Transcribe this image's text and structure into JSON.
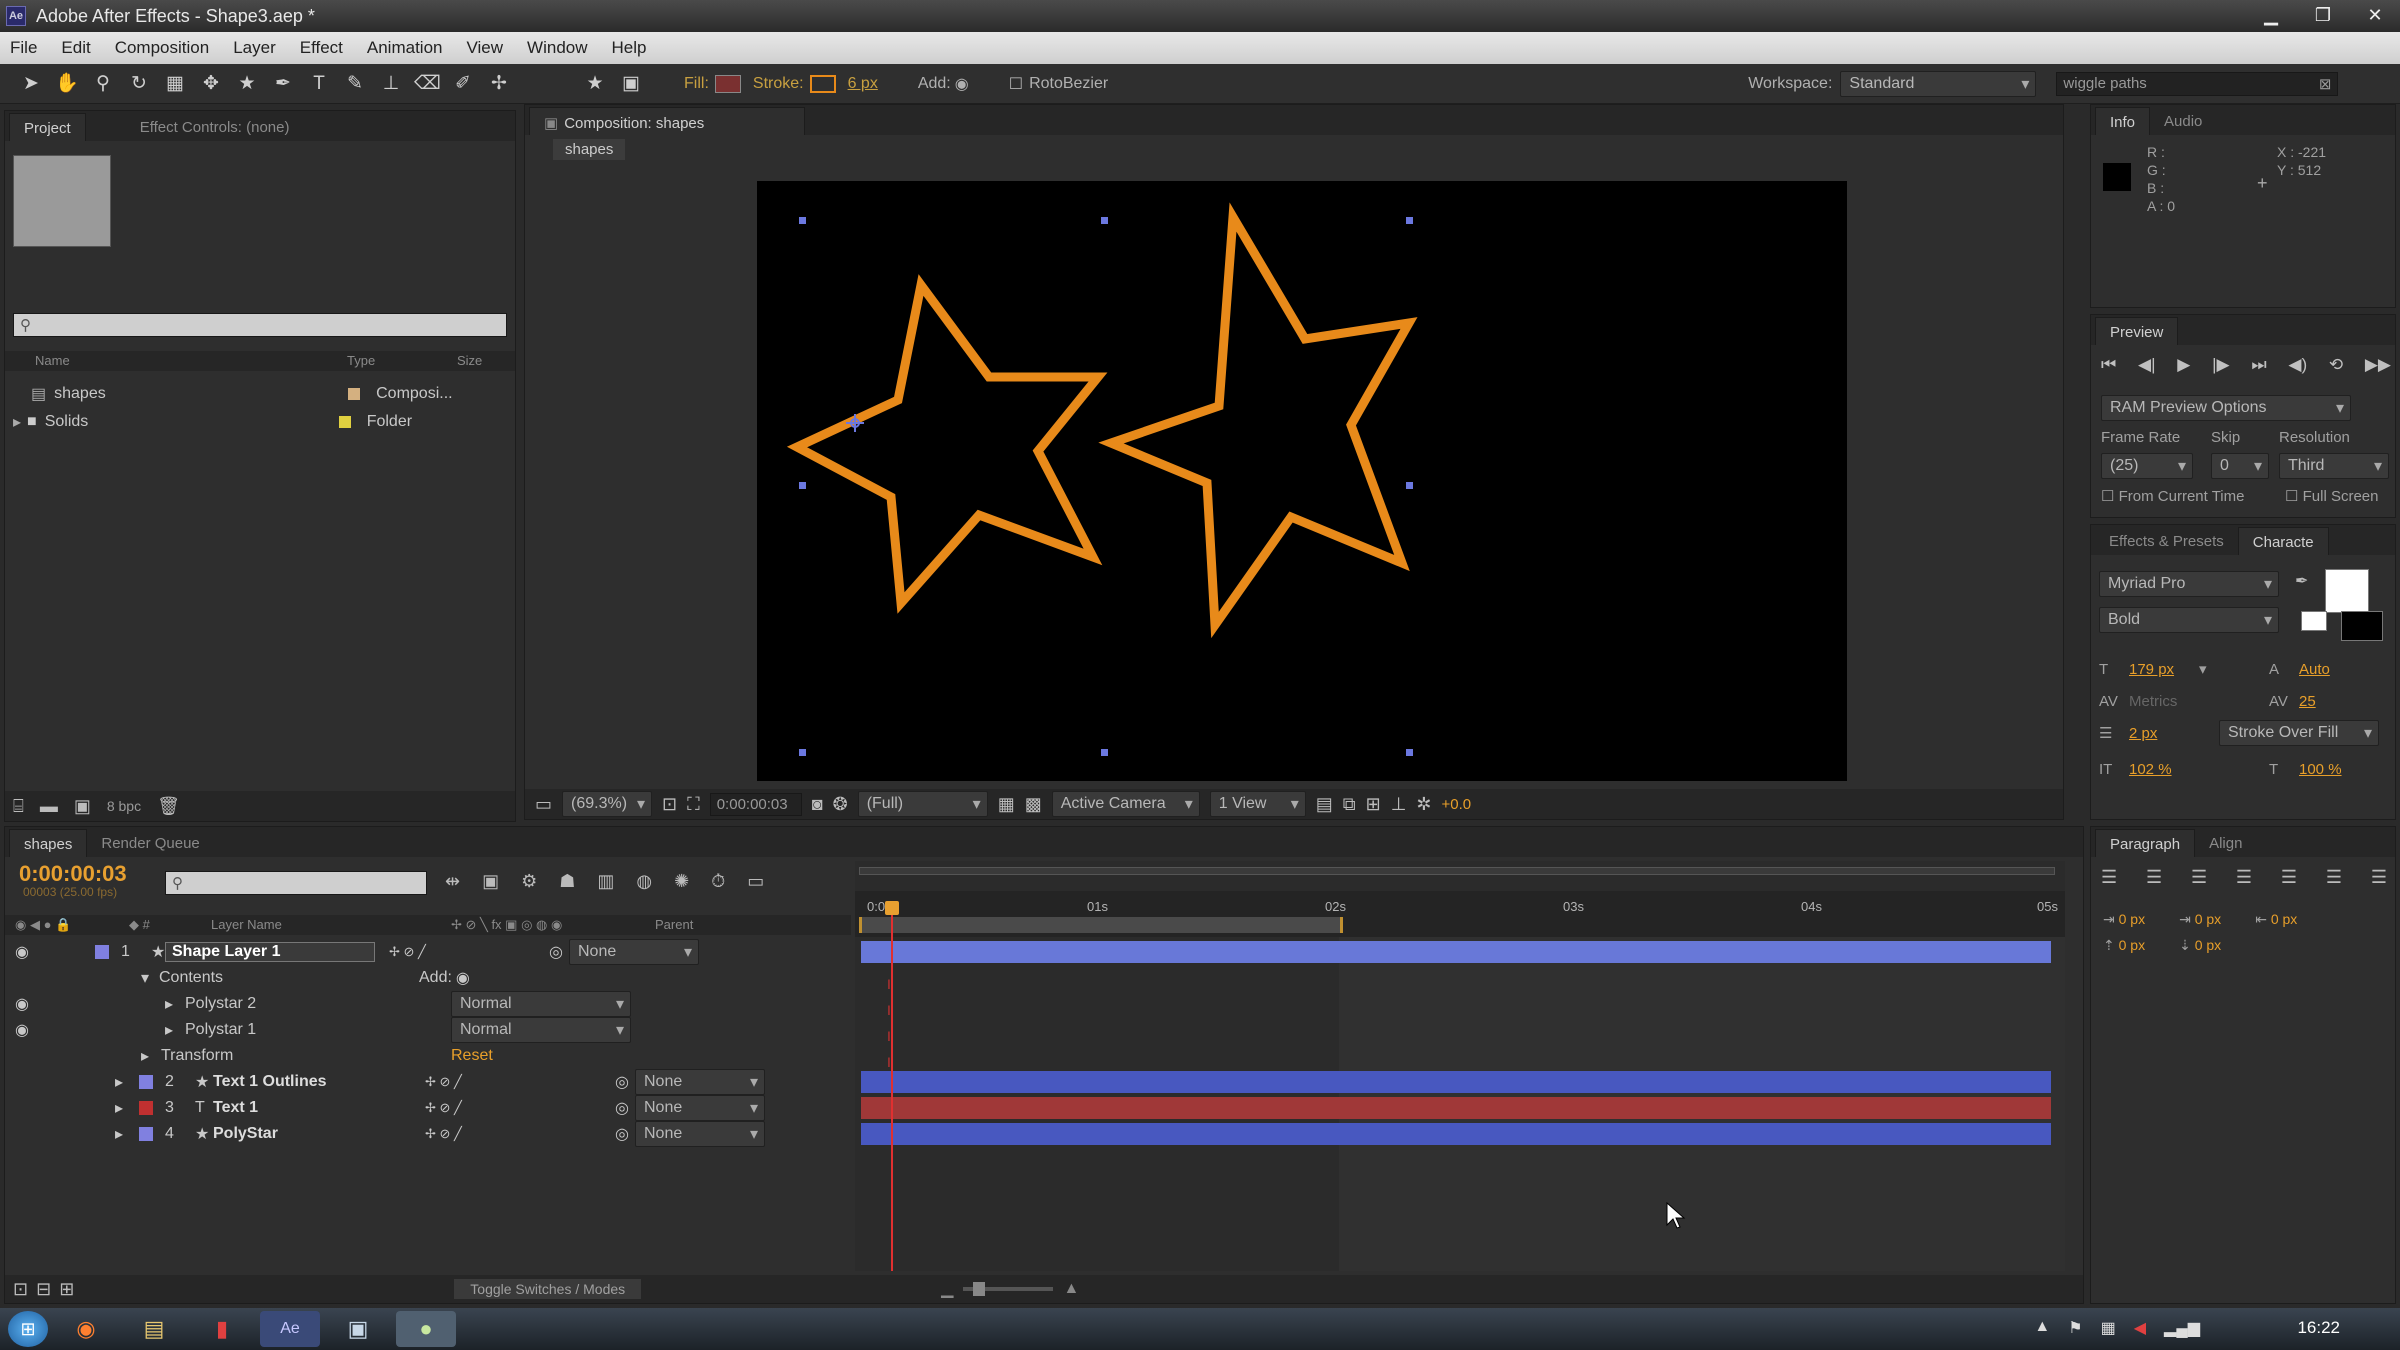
{
  "app": {
    "title": "Adobe After Effects - Shape3.aep *"
  },
  "menu": [
    "File",
    "Edit",
    "Composition",
    "Layer",
    "Effect",
    "Animation",
    "View",
    "Window",
    "Help"
  ],
  "toolbar": {
    "fill_label": "Fill:",
    "stroke_label": "Stroke:",
    "stroke_width": "6 px",
    "add_label": "Add:",
    "rotobezier": "RotoBezier",
    "workspace_label": "Workspace:",
    "workspace_value": "Standard",
    "search_value": "wiggle paths",
    "stroke_color": "#e88a1a"
  },
  "project_panel": {
    "tab_project": "Project",
    "tab_effect_controls": "Effect Controls: (none)",
    "col_name": "Name",
    "col_type": "Type",
    "col_size": "Size",
    "items": [
      {
        "name": "shapes",
        "type": "Composi...",
        "color": "#d4b080"
      },
      {
        "name": "Solids",
        "type": "Folder",
        "color": "#e0d040"
      }
    ],
    "bpc": "8 bpc"
  },
  "comp_panel": {
    "tab": "Composition: shapes",
    "breadcrumb": "shapes",
    "zoom": "(69.3%)",
    "timecode": "0:00:00:03",
    "resolution": "(Full)",
    "camera": "Active Camera",
    "views": "1 View",
    "exposure": "+0.0"
  },
  "info_panel": {
    "tab_info": "Info",
    "tab_audio": "Audio",
    "r": "R :",
    "g": "G :",
    "b": "B :",
    "a": "A : 0",
    "x": "X : -221",
    "y": "Y : 512"
  },
  "preview_panel": {
    "tab": "Preview",
    "ram_options": "RAM Preview Options",
    "frame_rate_label": "Frame Rate",
    "skip_label": "Skip",
    "resolution_label": "Resolution",
    "frame_rate": "(25)",
    "skip": "0",
    "resolution": "Third",
    "from_current": "From Current Time",
    "full_screen": "Full Screen"
  },
  "character_panel": {
    "tab_effects": "Effects & Presets",
    "tab_character": "Characte",
    "font": "Myriad Pro",
    "style": "Bold",
    "size": "179 px",
    "leading": "Auto",
    "kerning": "Metrics",
    "tracking": "25",
    "stroke_size": "2 px",
    "stroke_mode": "Stroke Over Fill",
    "vscale": "102 %",
    "hscale": "100 %"
  },
  "paragraph_panel": {
    "tab_paragraph": "Paragraph",
    "tab_align": "Align",
    "indent_left": "0 px",
    "indent_first": "0 px",
    "indent_right": "0 px",
    "space_before": "0 px",
    "space_after": "0 px"
  },
  "timeline": {
    "tab": "shapes",
    "tab_render": "Render Queue",
    "timecode": "0:00:00:03",
    "frames": "00003 (25.00 fps)",
    "col_layer_name": "Layer Name",
    "col_parent": "Parent",
    "ruler": [
      "0:00s",
      "01s",
      "02s",
      "03s",
      "04s",
      "05s"
    ],
    "layers": [
      {
        "num": "1",
        "name": "Shape Layer 1",
        "parent": "None",
        "color": "#8080e0",
        "bar": "#6878d8"
      },
      {
        "num": "2",
        "name": "Text 1 Outlines",
        "parent": "None",
        "color": "#8080e0",
        "bar": "#4858c0"
      },
      {
        "num": "3",
        "name": "Text 1",
        "parent": "None",
        "color": "#c03030",
        "bar": "#a03838"
      },
      {
        "num": "4",
        "name": "PolyStar",
        "parent": "None",
        "color": "#8080e0",
        "bar": "#4858c0"
      }
    ],
    "contents_label": "Contents",
    "add_label": "Add:",
    "polystar2": "Polystar 2",
    "polystar1": "Polystar 1",
    "mode_normal": "Normal",
    "transform_label": "Transform",
    "reset_label": "Reset",
    "toggle_label": "Toggle Switches / Modes"
  },
  "taskbar": {
    "clock": "16:22"
  }
}
